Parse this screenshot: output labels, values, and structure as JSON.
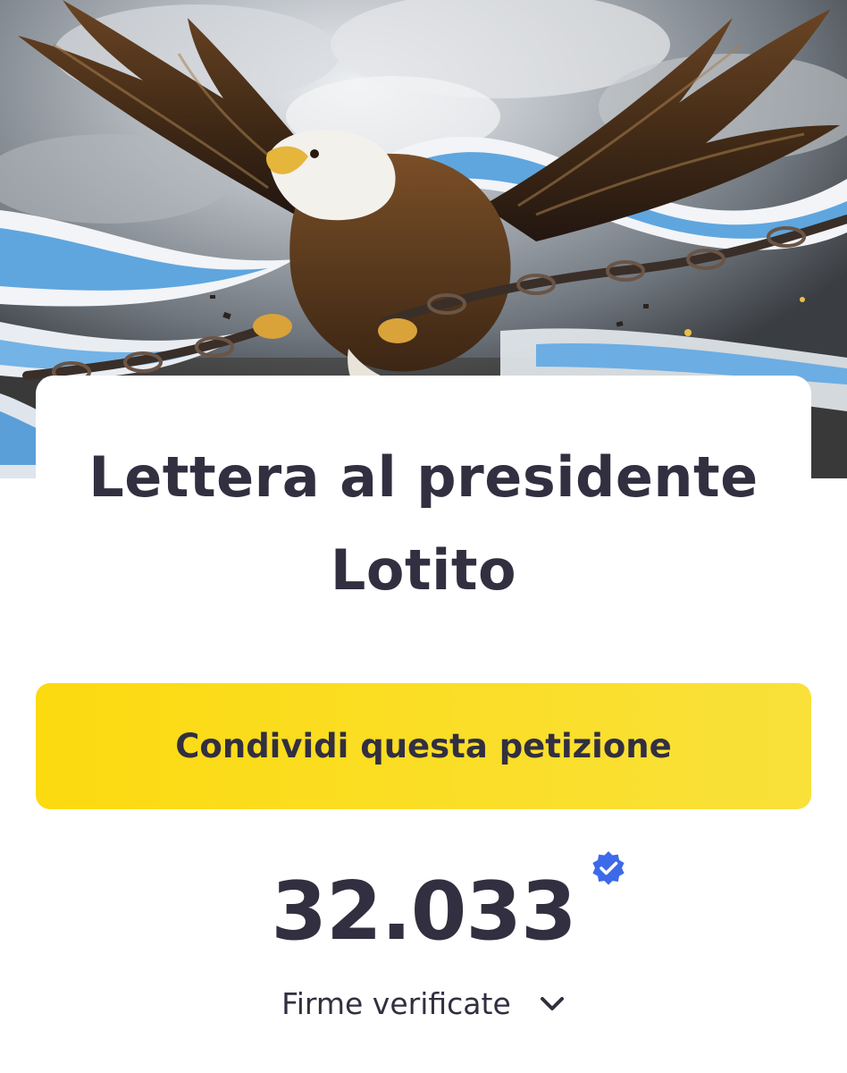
{
  "hero": {
    "image_description_icon": "eagle-breaking-chains-icon",
    "colors": {
      "sky": "#8c949c",
      "flag_blue": "#5fa6df",
      "flag_white": "#f2f4f7",
      "eagle_brown": "#5a3a1f",
      "chain": "#3a2e28"
    }
  },
  "petition": {
    "title": "Lettera al presidente Lotito",
    "share_label": "Condividi questa petizione",
    "signature_count": "32.033",
    "signatures_label": "Firme verificate"
  },
  "icons": {
    "verified": "verified-badge-icon",
    "expand": "chevron-down-icon"
  },
  "colors": {
    "text": "#322f40",
    "accent_yellow": "#fcda10",
    "verified_blue": "#3d6ae8"
  }
}
